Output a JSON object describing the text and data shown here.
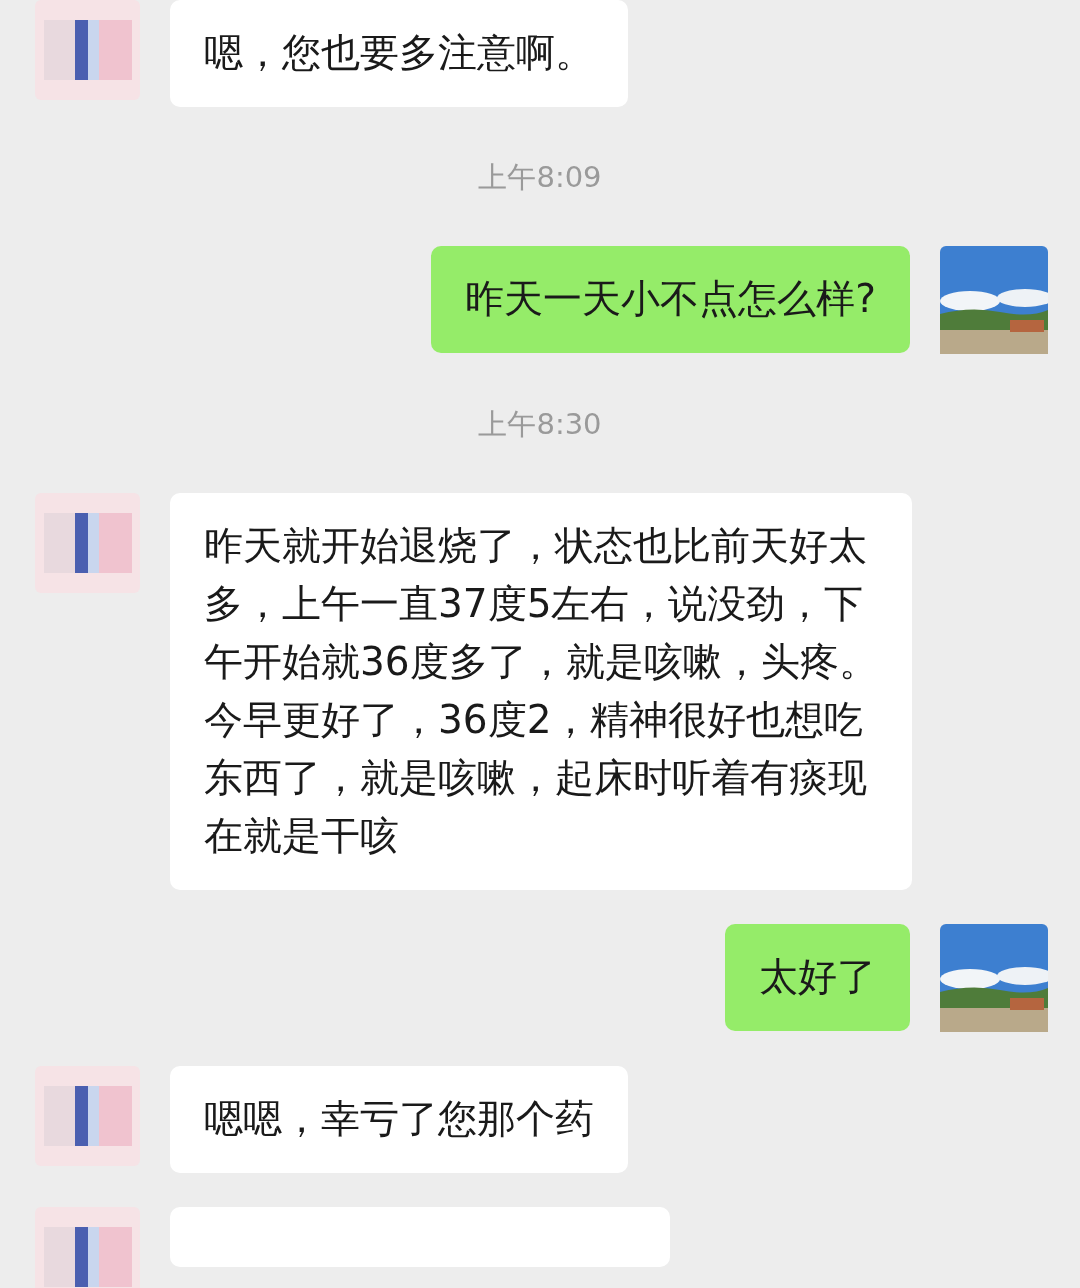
{
  "messages": [
    {
      "kind": "incoming",
      "text": "嗯，您也要多注意啊。"
    },
    {
      "kind": "time",
      "text": "上午8:09"
    },
    {
      "kind": "outgoing",
      "text": "昨天一天小不点怎么样?"
    },
    {
      "kind": "time",
      "text": "上午8:30"
    },
    {
      "kind": "incoming",
      "text": "昨天就开始退烧了，状态也比前天好太多，上午一直37度5左右，说没劲，下午开始就36度多了，就是咳嗽，头疼。今早更好了，36度2，精神很好也想吃东西了，就是咳嗽，起床时听着有痰现在就是干咳"
    },
    {
      "kind": "outgoing",
      "text": "太好了"
    },
    {
      "kind": "incoming",
      "text": "嗯嗯，幸亏了您那个药"
    },
    {
      "kind": "partial"
    }
  ]
}
